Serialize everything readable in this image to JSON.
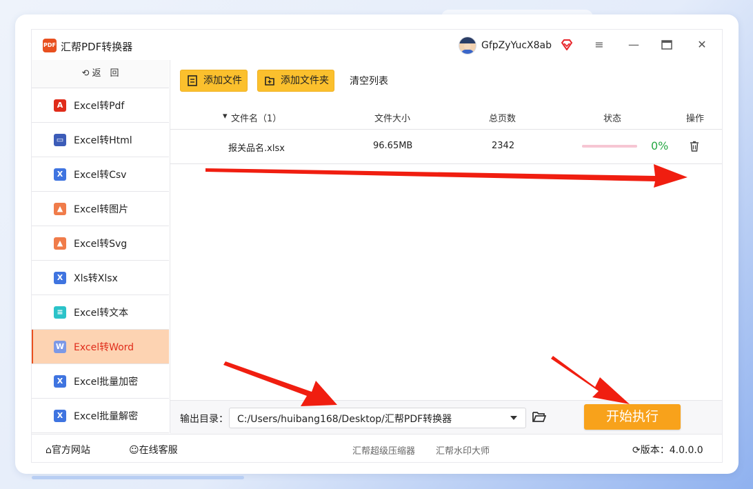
{
  "window": {
    "title": "汇帮PDF转换器",
    "logo_text": "PDF",
    "username": "GfpZyYucX8ab",
    "controls": [
      "menu",
      "minimize",
      "maximize",
      "close"
    ]
  },
  "sidebar": {
    "back_label": "返　回",
    "items": [
      {
        "label": "Excel转Pdf",
        "icon": "pdf-icon",
        "color": "#e02c1a",
        "glyph": "A"
      },
      {
        "label": "Excel转Html",
        "icon": "html-icon",
        "color": "#3c5cb8",
        "glyph": "▭"
      },
      {
        "label": "Excel转Csv",
        "icon": "csv-icon",
        "color": "#3f74e0",
        "glyph": "X"
      },
      {
        "label": "Excel转图片",
        "icon": "image-icon",
        "color": "#f07c4a",
        "glyph": "▲"
      },
      {
        "label": "Excel转Svg",
        "icon": "svg-image-icon",
        "color": "#f07c4a",
        "glyph": "▲"
      },
      {
        "label": "Xls转Xlsx",
        "icon": "xlsx-icon",
        "color": "#3f74e0",
        "glyph": "X"
      },
      {
        "label": "Excel转文本",
        "icon": "text-icon",
        "color": "#2bc3c9",
        "glyph": "≡"
      },
      {
        "label": "Excel转Word",
        "icon": "word-icon",
        "color": "#7c99e6",
        "glyph": "W",
        "active": true
      },
      {
        "label": "Excel批量加密",
        "icon": "excel-lock-icon",
        "color": "#3f74e0",
        "glyph": "X"
      },
      {
        "label": "Excel批量解密",
        "icon": "excel-unlock-icon",
        "color": "#3f74e0",
        "glyph": "X"
      }
    ]
  },
  "toolbar": {
    "add_file": "添加文件",
    "add_folder": "添加文件夹",
    "clear_list": "清空列表"
  },
  "table": {
    "headers": {
      "filename": "文件名（1）",
      "size": "文件大小",
      "pages": "总页数",
      "status": "状态",
      "action": "操作"
    },
    "rows": [
      {
        "filename": "报关品名.xlsx",
        "size": "96.65MB",
        "pages": "2342",
        "progress_percent": 0,
        "progress_text": "0%"
      }
    ]
  },
  "output": {
    "label": "输出目录：",
    "path": "C:/Users/huibang168/Desktop/汇帮PDF转换器",
    "start_button": "开始执行"
  },
  "footer": {
    "website": "官方网站",
    "support": "在线客服",
    "compressor": "汇帮超级压缩器",
    "watermark": "汇帮水印大师",
    "version": "版本：4.0.0.0"
  },
  "colors": {
    "accent_yellow": "#fbc02d",
    "start_orange": "#f8a21b",
    "active_bg": "#fdd3b2",
    "active_text": "#e02c1a",
    "success_green": "#27a844",
    "annotation_red": "#f01e10"
  }
}
